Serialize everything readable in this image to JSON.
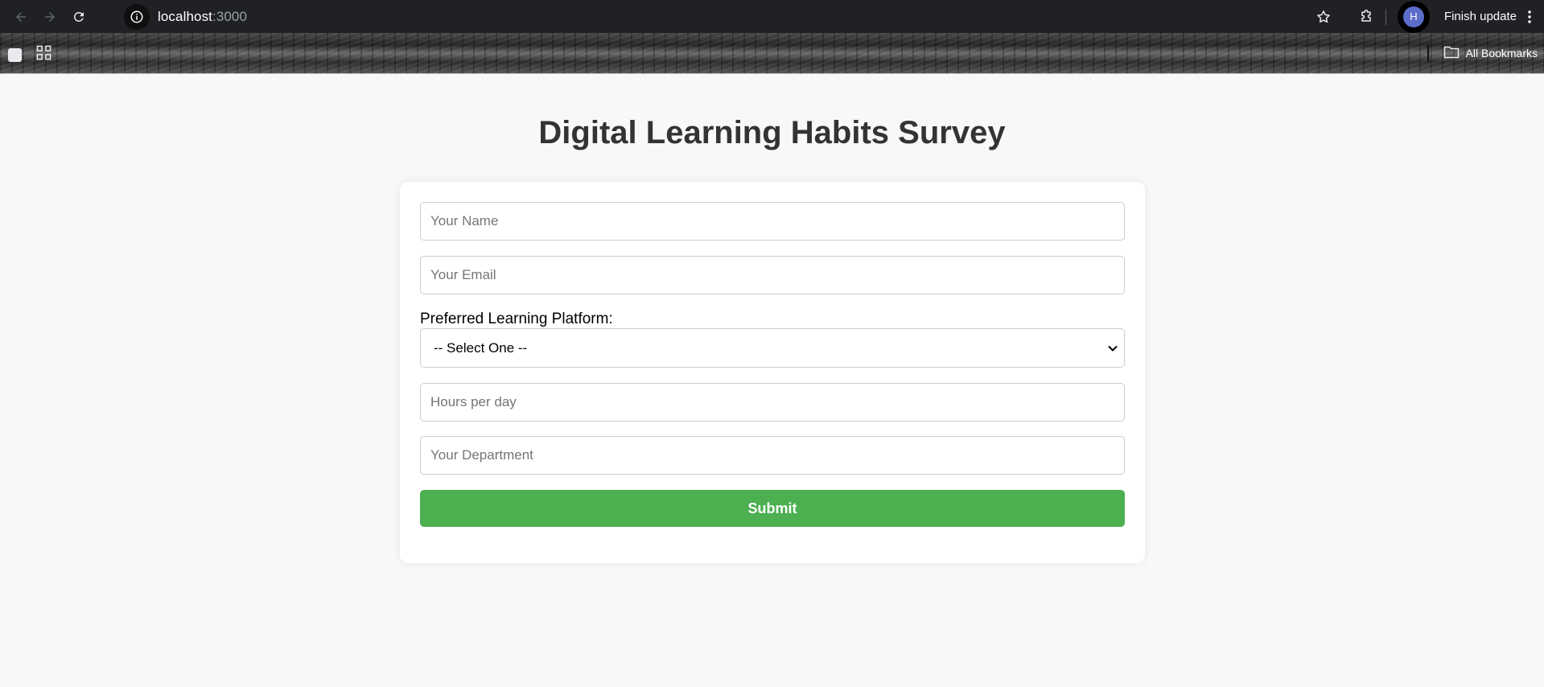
{
  "browser": {
    "url_host": "localhost",
    "url_port": ":3000",
    "update_label": "Finish update",
    "avatar_initial": "H",
    "bookmarks_label": "All Bookmarks"
  },
  "survey": {
    "title": "Digital Learning Habits Survey",
    "name_placeholder": "Your Name",
    "email_placeholder": "Your Email",
    "platform_label": "Preferred Learning Platform:",
    "platform_selected": "-- Select One --",
    "hours_placeholder": "Hours per day",
    "department_placeholder": "Your Department",
    "submit_label": "Submit"
  },
  "colors": {
    "submit": "#4caf50",
    "title": "#333333",
    "background": "#f8f8f8",
    "avatar": "#5b6cc9"
  },
  "icons": [
    "back-arrow-icon",
    "forward-arrow-icon",
    "reload-icon",
    "site-info-icon",
    "bookmark-star-icon",
    "extensions-icon",
    "more-vert-icon",
    "tab-groups-icon",
    "apps-grid-icon",
    "folder-icon",
    "chevron-down-icon"
  ]
}
